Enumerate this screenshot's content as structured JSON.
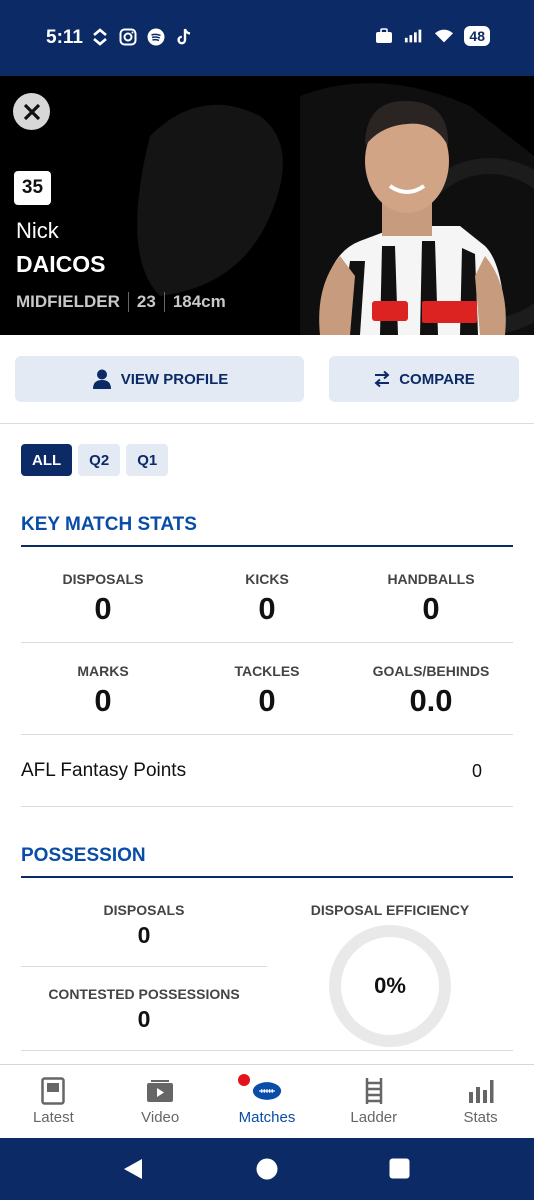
{
  "status_bar": {
    "time": "5:11",
    "battery": "48",
    "icons_left": [
      "double-chevron-icon",
      "instagram-icon",
      "spotify-icon",
      "tiktok-icon"
    ],
    "icons_right": [
      "briefcase-icon",
      "signal-icon",
      "wifi-icon",
      "battery-icon"
    ]
  },
  "player": {
    "number": "35",
    "first_name": "Nick",
    "last_name": "DAICOS",
    "position": "MIDFIELDER",
    "age": "23",
    "height": "184cm"
  },
  "actions": {
    "view_profile": "VIEW PROFILE",
    "compare": "COMPARE"
  },
  "filters": {
    "tabs": [
      "ALL",
      "Q2",
      "Q1"
    ],
    "selected": "ALL"
  },
  "key_match_stats": {
    "title": "KEY MATCH STATS",
    "row1": [
      {
        "label": "DISPOSALS",
        "value": "0"
      },
      {
        "label": "KICKS",
        "value": "0"
      },
      {
        "label": "HANDBALLS",
        "value": "0"
      }
    ],
    "row2": [
      {
        "label": "MARKS",
        "value": "0"
      },
      {
        "label": "TACKLES",
        "value": "0"
      },
      {
        "label": "GOALS/BEHINDS",
        "value": "0.0"
      }
    ],
    "fantasy_label": "AFL Fantasy Points",
    "fantasy_value": "0"
  },
  "possession": {
    "title": "POSSESSION",
    "disposals_label": "DISPOSALS",
    "disposals_value": "0",
    "contested_label": "CONTESTED POSSESSIONS",
    "contested_value": "0",
    "efficiency_label": "DISPOSAL EFFICIENCY",
    "efficiency_value": "0%"
  },
  "bottom_nav": {
    "items": [
      {
        "label": "Latest",
        "icon": "news-icon"
      },
      {
        "label": "Video",
        "icon": "video-icon"
      },
      {
        "label": "Matches",
        "icon": "football-icon"
      },
      {
        "label": "Ladder",
        "icon": "ladder-icon"
      },
      {
        "label": "Stats",
        "icon": "bar-chart-icon"
      }
    ],
    "active": "Matches"
  },
  "colors": {
    "navy": "#0b2a66",
    "accent_blue": "#0a4da8",
    "button_bg": "#e4eaf3",
    "notification_red": "#e3141b"
  }
}
